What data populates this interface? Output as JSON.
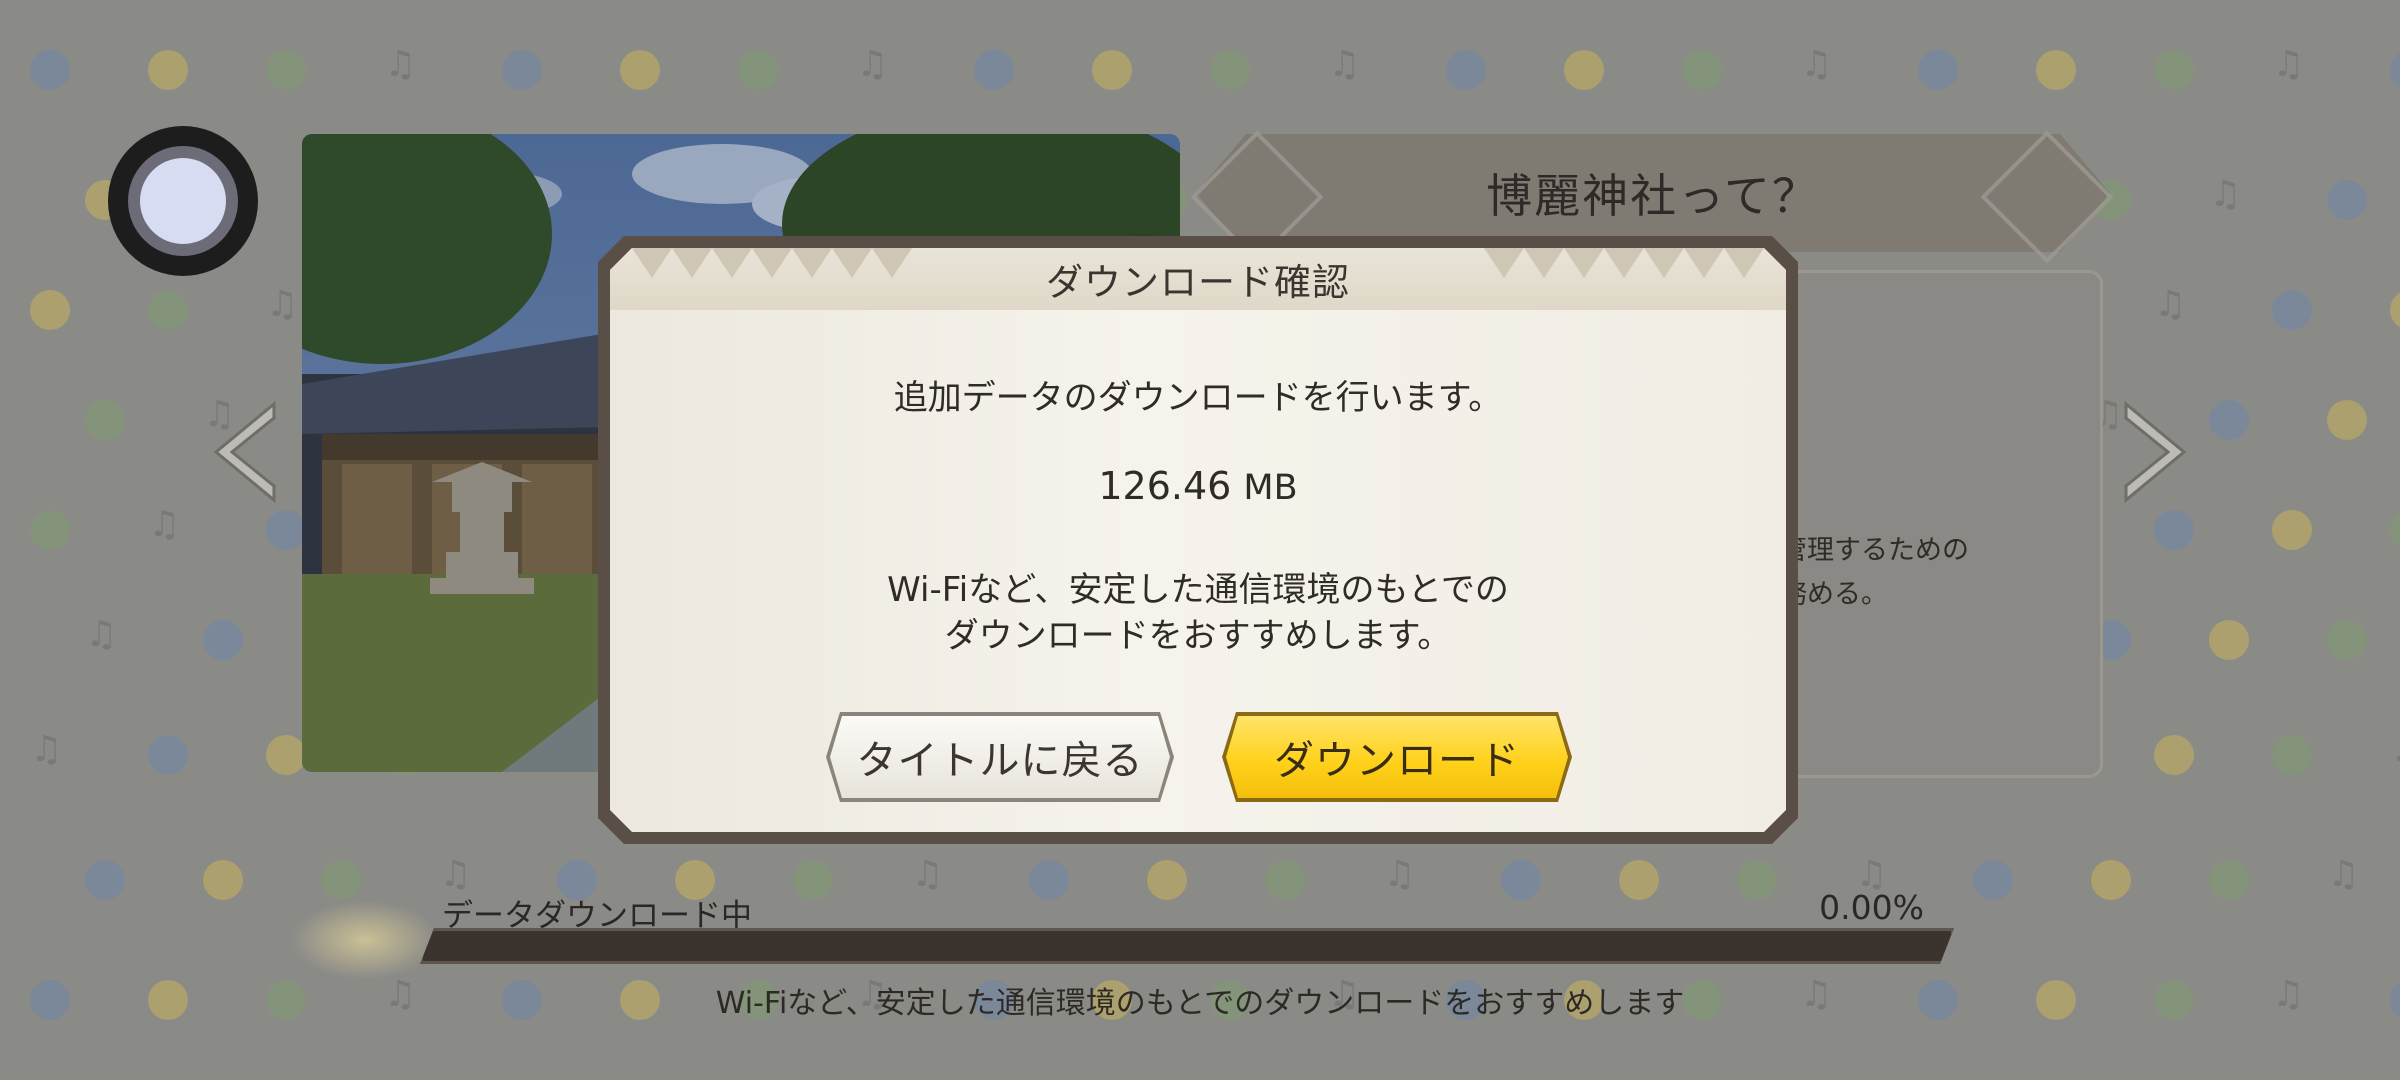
{
  "background": {
    "icon_colors": [
      "#b9676f",
      "#6d86a8",
      "#c9b45a",
      "#7d9d6f"
    ]
  },
  "info_panel": {
    "title": "博麗神社って？",
    "desc_line1": "管理するための",
    "desc_line2": "務める。"
  },
  "dialog": {
    "title": "ダウンロード確認",
    "message": "追加データのダウンロードを行います。",
    "size_value": "126.46",
    "size_unit": "MB",
    "note_line1": "Wi-Fiなど、安定した通信環境のもとでの",
    "note_line2": "ダウンロードをおすすめします。",
    "back_button": "タイトルに戻る",
    "download_button": "ダウンロード"
  },
  "progress": {
    "label": "データダウンロード中",
    "percent_text": "0.00%",
    "value": 0.0,
    "note": "Wi-Fiなど、安定した通信環境のもとでのダウンロードをおすすめします"
  }
}
